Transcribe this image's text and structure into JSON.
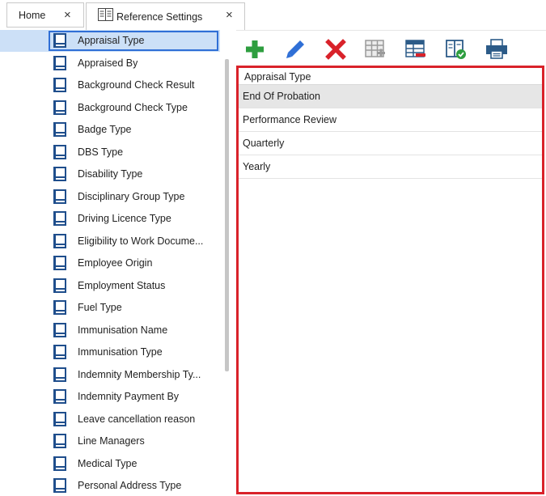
{
  "tabs": [
    {
      "label": "Home",
      "close": "×"
    },
    {
      "label": "Reference Settings",
      "close": "×"
    }
  ],
  "tree": {
    "selected_index": 0,
    "items": [
      "Appraisal Type",
      "Appraised By",
      "Background Check Result",
      "Background Check Type",
      "Badge Type",
      "DBS Type",
      "Disability Type",
      "Disciplinary Group Type",
      "Driving Licence Type",
      "Eligibility to Work Docume...",
      "Employee Origin",
      "Employment Status",
      "Fuel Type",
      "Immunisation Name",
      "Immunisation Type",
      "Indemnity Membership Ty...",
      "Indemnity Payment By",
      "Leave cancellation reason",
      "Line Managers",
      "Medical Type",
      "Personal Address Type"
    ]
  },
  "toolbar": {
    "buttons": [
      {
        "name": "add-button",
        "icon": "plus-icon",
        "color": "#2e9e3f"
      },
      {
        "name": "edit-button",
        "icon": "pencil-icon",
        "color": "#2f6fd6"
      },
      {
        "name": "delete-button",
        "icon": "x-icon",
        "color": "#d9222a"
      },
      {
        "name": "add-row-button",
        "icon": "grid-add-icon",
        "color": "#9a9a9a"
      },
      {
        "name": "remove-row-button",
        "icon": "grid-remove-icon",
        "color": "#d9222a"
      },
      {
        "name": "approve-button",
        "icon": "book-check-icon",
        "color": "#2e9e3f"
      },
      {
        "name": "print-button",
        "icon": "printer-icon",
        "color": "#2f6fd6"
      }
    ]
  },
  "grid": {
    "column_header": "Appraisal Type",
    "rows": [
      "End Of Probation",
      "Performance Review",
      "Quarterly",
      "Yearly"
    ],
    "focused_row": 0
  },
  "colors": {
    "accent": "#2f6fd6",
    "selection": "#cce0f7",
    "highlight_border": "#d9222a"
  }
}
